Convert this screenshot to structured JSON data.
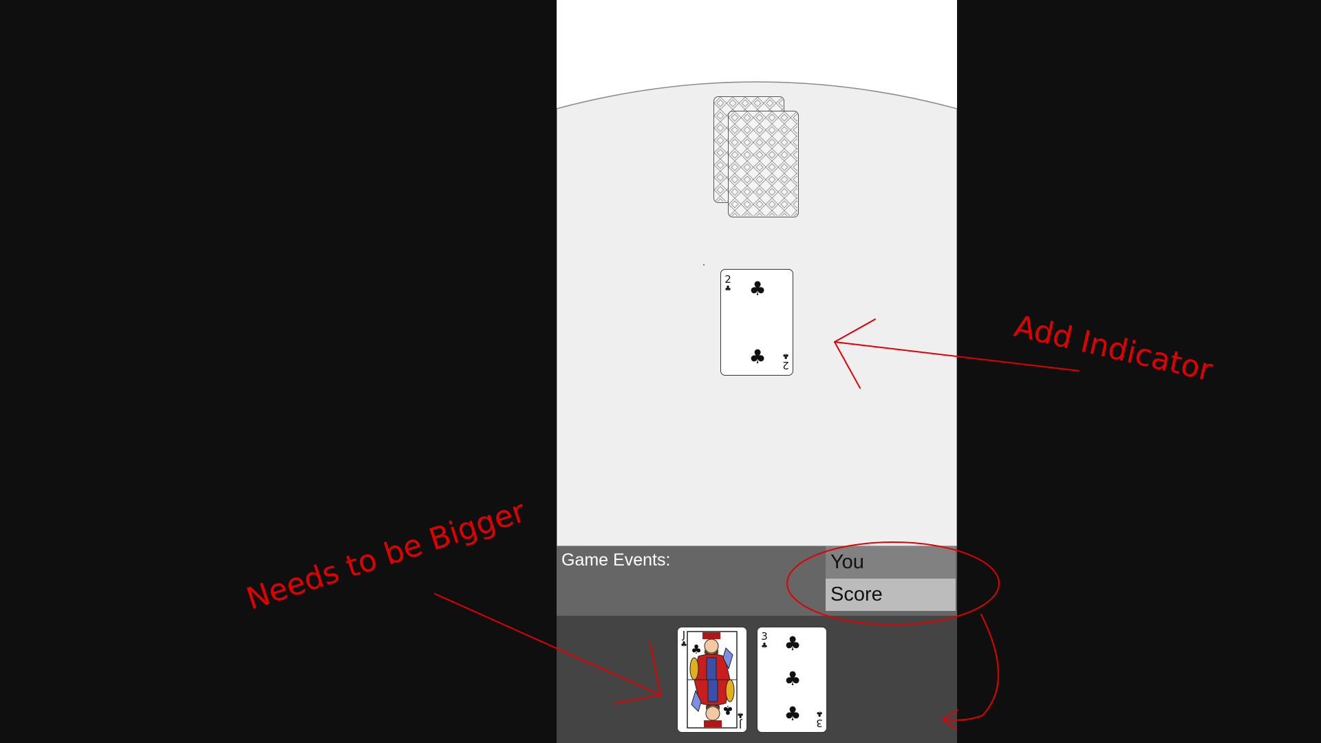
{
  "game_events": {
    "label": "Game Events:"
  },
  "score_list": {
    "items": [
      "You",
      "Score"
    ]
  },
  "played_card": {
    "rank": "2",
    "suit": "clubs",
    "suit_glyph": "♣"
  },
  "hand": [
    {
      "rank": "J",
      "suit": "clubs",
      "suit_glyph": "♣",
      "face": "jack"
    },
    {
      "rank": "3",
      "suit": "clubs",
      "suit_glyph": "♣"
    }
  ],
  "deck": {
    "visible_backs": 2
  },
  "annotations": {
    "add_indicator": "Add Indicator",
    "needs_bigger": "Needs to be Bigger",
    "color": "#e00000"
  },
  "colors": {
    "outer_background": "#0f0f0f",
    "table": "#efefef",
    "events_panel": "#666666",
    "hand_area": "#444444",
    "score_you_row": "#818181",
    "score_row": "#bcbcbc"
  }
}
